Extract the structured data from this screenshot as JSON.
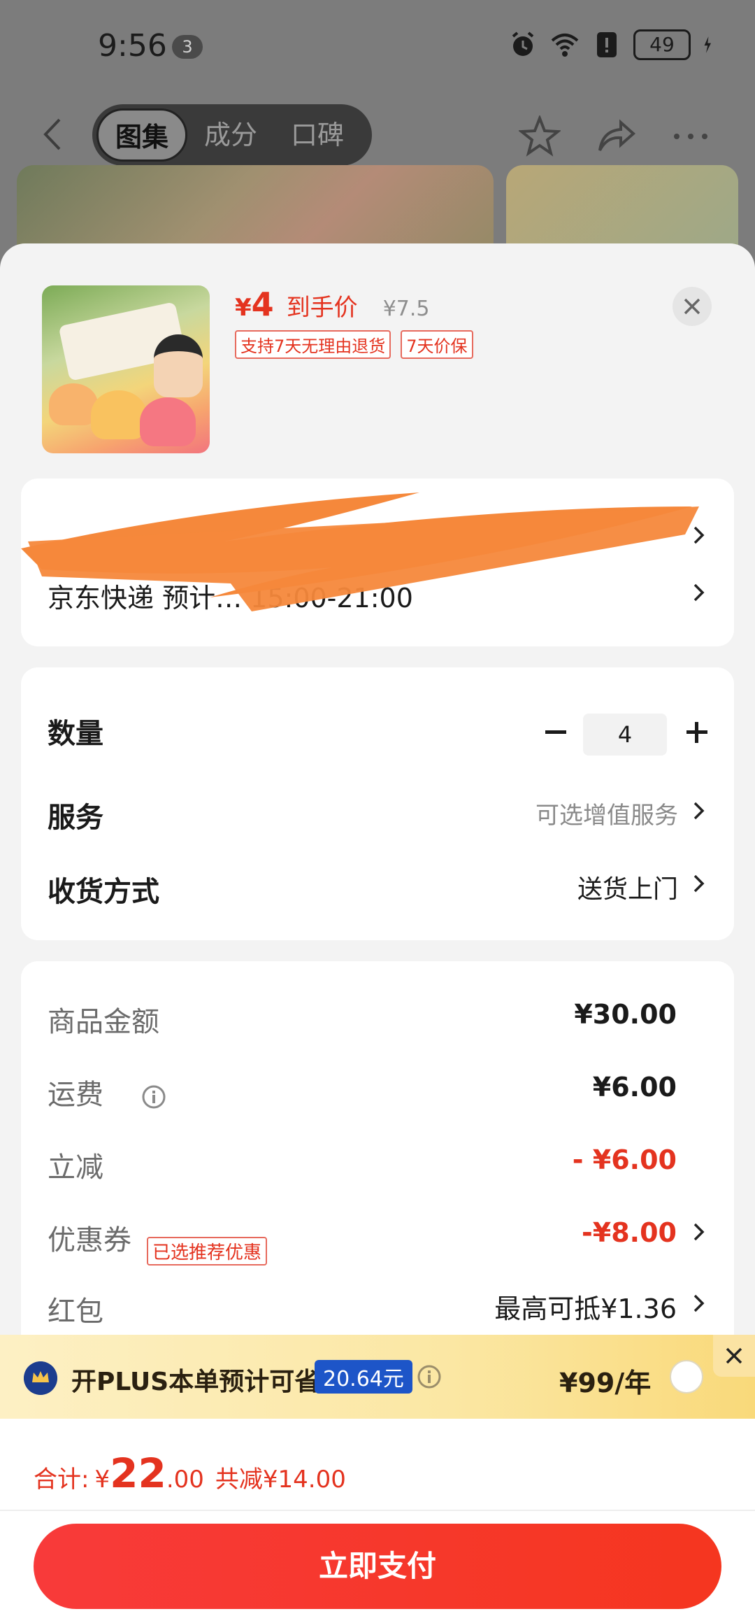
{
  "status_bar": {
    "time": "9:56",
    "notification_count": "3",
    "battery": "49"
  },
  "nav": {
    "tabs": [
      {
        "label": "图集"
      },
      {
        "label": "成分"
      },
      {
        "label": "口碑"
      }
    ]
  },
  "product": {
    "price_yen": "¥",
    "price_value": "4",
    "price_label": "到手价",
    "original_price": "¥7.5",
    "tags": [
      "支持7天无理由退货",
      "7天价保"
    ]
  },
  "address": {
    "line1": "",
    "line2": "京东快递 预计…   15:00-21:00"
  },
  "options": {
    "quantity_label": "数量",
    "quantity_value": "4",
    "service_label": "服务",
    "service_value": "可选增值服务",
    "delivery_label": "收货方式",
    "delivery_value": "送货上门"
  },
  "summary": {
    "goods_label": "商品金额",
    "goods_value": "¥30.00",
    "shipping_label": "运费",
    "shipping_value": "¥6.00",
    "discount_label": "立减",
    "discount_value": "- ¥6.00",
    "coupon_label": "优惠券",
    "coupon_tag": "已选推荐优惠",
    "coupon_value": "-¥8.00",
    "redpacket_label": "红包",
    "redpacket_value": "最高可抵¥1.36"
  },
  "plus_banner": {
    "text": "开PLUS本单预计可省",
    "amount": "20.64元",
    "price": "¥99/年"
  },
  "total": {
    "label": "合计:",
    "yen": "¥",
    "integer": "22",
    "decimal": ".00",
    "saved": "共减¥14.00"
  },
  "pay_button": "立即支付",
  "colors": {
    "accent_red": "#e4331f",
    "plus_blue": "#1d55c8"
  }
}
